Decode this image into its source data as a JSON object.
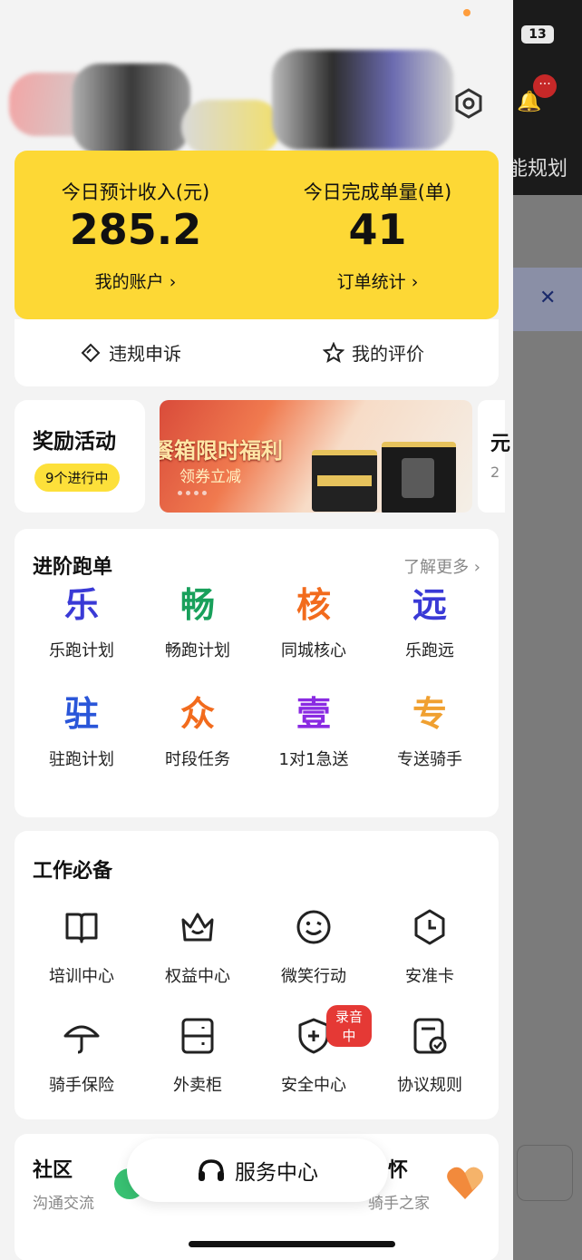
{
  "background_app": {
    "battery": "13",
    "badge": "···",
    "partial_text": "能规划"
  },
  "stats": {
    "income_label": "今日预计收入(元)",
    "income_value": "285.2",
    "account_link": "我的账户 ›",
    "orders_label": "今日完成单量(单)",
    "orders_value": "41",
    "orders_link": "订单统计 ›"
  },
  "actions": {
    "appeal": "违规申诉",
    "rating": "我的评价"
  },
  "reward": {
    "title": "奖励活动",
    "badge": "9个进行中",
    "banner_title": "餐箱限时福利",
    "banner_sub": "领券立减",
    "peek_title": "元",
    "peek_sub": "2"
  },
  "advanced": {
    "title": "进阶跑单",
    "more": "了解更多 ›",
    "items": [
      {
        "glyph": "乐",
        "label": "乐跑计划",
        "color": "#3a3ad6"
      },
      {
        "glyph": "畅",
        "label": "畅跑计划",
        "color": "#18a05b"
      },
      {
        "glyph": "核",
        "label": "同城核心",
        "color": "#f26b1d"
      },
      {
        "glyph": "远",
        "label": "乐跑远",
        "color": "#3a3ad6"
      },
      {
        "glyph": "驻",
        "label": "驻跑计划",
        "color": "#2a56d9"
      },
      {
        "glyph": "众",
        "label": "时段任务",
        "color": "#f26b1d"
      },
      {
        "glyph": "壹",
        "label": "1对1急送",
        "color": "#8a2be2"
      },
      {
        "glyph": "专",
        "label": "专送骑手",
        "color": "#f0a030"
      }
    ]
  },
  "work": {
    "title": "工作必备",
    "items": [
      {
        "icon": "book-icon",
        "label": "培训中心"
      },
      {
        "icon": "crown-icon",
        "label": "权益中心"
      },
      {
        "icon": "smile-icon",
        "label": "微笑行动"
      },
      {
        "icon": "clock-card-icon",
        "label": "安准卡"
      },
      {
        "icon": "umbrella-icon",
        "label": "骑手保险"
      },
      {
        "icon": "locker-icon",
        "label": "外卖柜"
      },
      {
        "icon": "shield-plus-icon",
        "label": "安全中心",
        "badge": "录音中"
      },
      {
        "icon": "document-check-icon",
        "label": "协议规则"
      }
    ]
  },
  "community": {
    "title": "社区",
    "sub": "沟通交流",
    "title2": "怀",
    "sub2": "骑手之家"
  },
  "service": {
    "label": "服务中心"
  },
  "colors": {
    "accent_yellow": "#fdd835",
    "badge_red": "#e53935"
  }
}
